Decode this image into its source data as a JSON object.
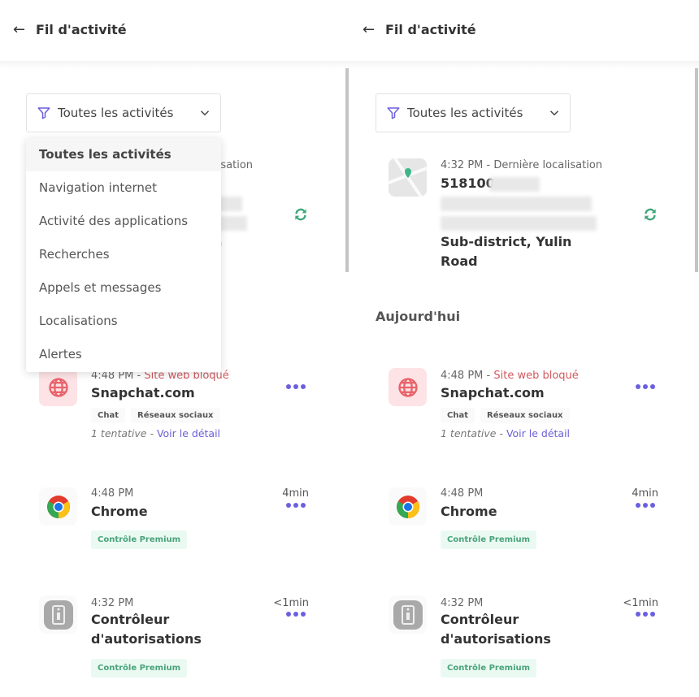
{
  "header": {
    "title": "Fil d'activité",
    "back_icon": "arrow-left-icon"
  },
  "filter": {
    "label": "Toutes les activités",
    "options": [
      "Toutes les activités",
      "Navigation internet",
      "Activité des applications",
      "Recherches",
      "Appels et messages",
      "Localisations",
      "Alertes"
    ]
  },
  "location": {
    "meta": "4:32 PM - Dernière localisation",
    "line1": "518100",
    "line2": "Sub-district, Yulin",
    "line3": "Road",
    "icon": "map-pin-icon",
    "refresh_icon": "refresh-icon"
  },
  "section": "Aujourd'hui",
  "blocked": {
    "time": "4:48 PM",
    "sep": " - ",
    "status": "Site web bloqué",
    "name": "Snapchat.com",
    "tags": [
      "Chat",
      "Réseaux sociaux"
    ],
    "attempts": "1 tentative",
    "dash": " - ",
    "link": "Voir le détail"
  },
  "chrome": {
    "time": "4:48 PM",
    "name": "Chrome",
    "duration": "4min",
    "badge": "Contrôle Premium"
  },
  "perm": {
    "time": "4:32 PM",
    "name1": "Contrôleur",
    "name2": "d'autorisations",
    "duration": "<1min",
    "badge": "Contrôle Premium"
  },
  "colors": {
    "accent": "#6b5fe0",
    "blocked": "#d0595e",
    "premium": "#4aa27a"
  }
}
